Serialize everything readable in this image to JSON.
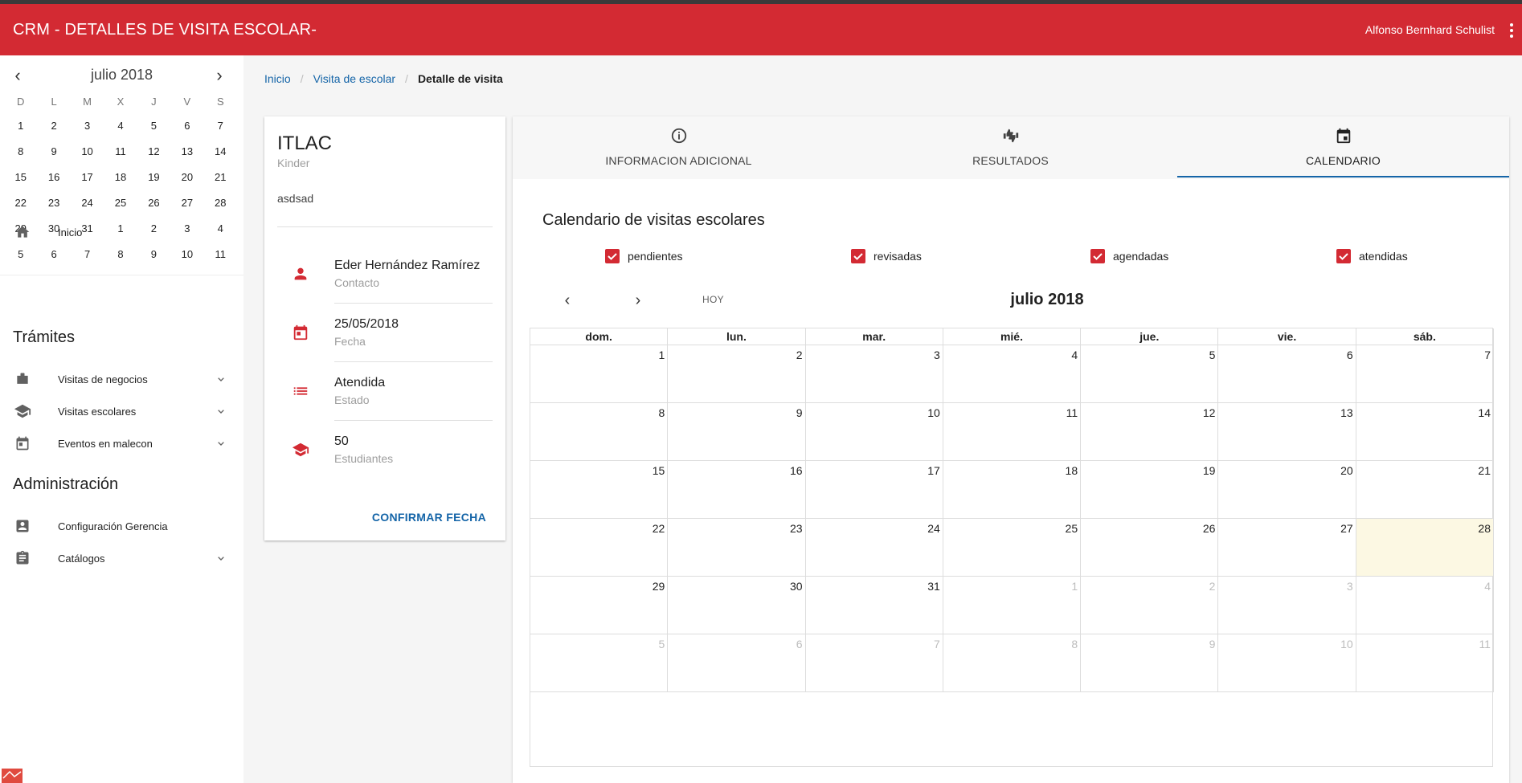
{
  "app": {
    "title": "CRM - DETALLES DE VISITA ESCOLAR-",
    "user": "Alfonso Bernhard Schulist",
    "accent": "#d32a33"
  },
  "mini_calendar": {
    "title": "julio 2018",
    "weekdays": [
      "D",
      "L",
      "M",
      "X",
      "J",
      "V",
      "S"
    ],
    "days": [
      "1",
      "2",
      "3",
      "4",
      "5",
      "6",
      "7",
      "8",
      "9",
      "10",
      "11",
      "12",
      "13",
      "14",
      "15",
      "16",
      "17",
      "18",
      "19",
      "20",
      "21",
      "22",
      "23",
      "24",
      "25",
      "26",
      "27",
      "28",
      "29",
      "30",
      "31",
      "1",
      "2",
      "3",
      "4",
      "5",
      "6",
      "7",
      "8",
      "9",
      "10",
      "11"
    ]
  },
  "sidebar": {
    "home": "Inicio",
    "tramites_title": "Trámites",
    "tramites": [
      "Visitas de negocios",
      "Visitas escolares",
      "Eventos en malecon"
    ],
    "admin_title": "Administración",
    "admin": [
      "Configuración Gerencia",
      "Catálogos"
    ]
  },
  "breadcrumb": {
    "items": [
      "Inicio",
      "Visita de escolar"
    ],
    "current": "Detalle de visita"
  },
  "detail": {
    "name": "ITLAC",
    "type": "Kinder",
    "description": "asdsad",
    "rows": [
      {
        "value": "Eder Hernández Ramírez",
        "label": "Contacto",
        "icon": "person-icon"
      },
      {
        "value": "25/05/2018",
        "label": "Fecha",
        "icon": "event-icon"
      },
      {
        "value": "Atendida",
        "label": "Estado",
        "icon": "list-icon"
      },
      {
        "value": "50",
        "label": "Estudiantes",
        "icon": "school-icon"
      }
    ],
    "confirm_label": "CONFIRMAR FECHA"
  },
  "tabs": [
    {
      "label": "INFORMACION ADICIONAL",
      "icon": "info-icon"
    },
    {
      "label": "RESULTADOS",
      "icon": "thumbs-icon"
    },
    {
      "label": "CALENDARIO",
      "icon": "calendar-icon",
      "active": true
    }
  ],
  "calendar": {
    "title": "Calendario de visitas escolares",
    "filters": [
      "pendientes",
      "revisadas",
      "agendadas",
      "atendidas"
    ],
    "today_label": "HOY",
    "month": "julio 2018",
    "weekdays": [
      "dom.",
      "lun.",
      "mar.",
      "mié.",
      "jue.",
      "vie.",
      "sáb."
    ],
    "weeks": [
      [
        "1",
        "2",
        "3",
        "4",
        "5",
        "6",
        "7"
      ],
      [
        "8",
        "9",
        "10",
        "11",
        "12",
        "13",
        "14"
      ],
      [
        "15",
        "16",
        "17",
        "18",
        "19",
        "20",
        "21"
      ],
      [
        "22",
        "23",
        "24",
        "25",
        "26",
        "27",
        "28"
      ],
      [
        "29",
        "30",
        "31",
        "1",
        "2",
        "3",
        "4"
      ],
      [
        "5",
        "6",
        "7",
        "8",
        "9",
        "10",
        "11"
      ]
    ],
    "today": "28"
  }
}
